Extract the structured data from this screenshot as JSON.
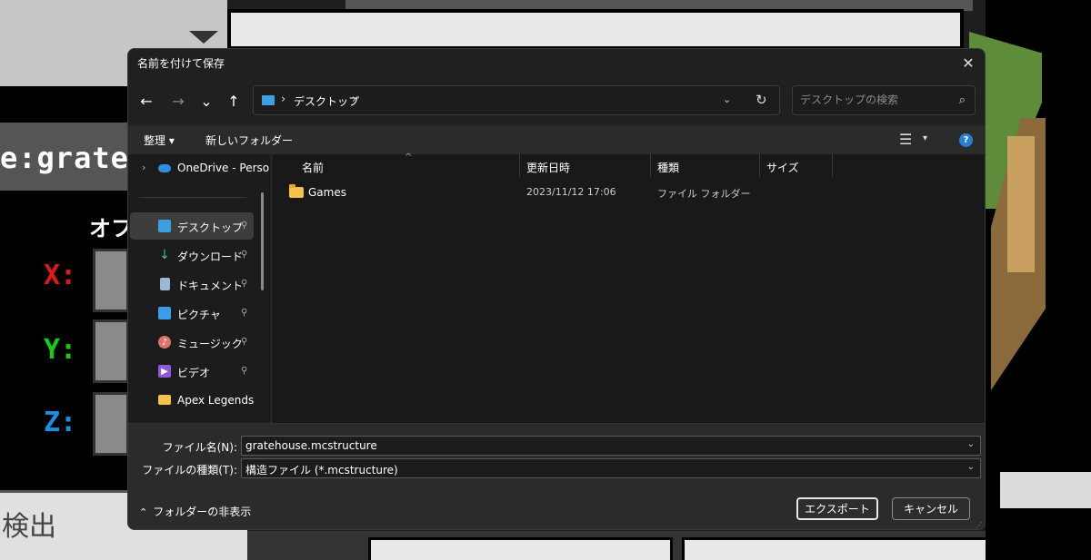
{
  "background": {
    "structure_name_partial": "e:grate",
    "ofu_partial": "オフ",
    "axis_x": "X:",
    "axis_y": "Y:",
    "axis_z": "Z:",
    "detect_label": "検出"
  },
  "dialog": {
    "title": "名前を付けて保存",
    "close_glyph": "✕",
    "nav": {
      "back": "←",
      "forward": "→",
      "recent": "⌄",
      "up": "↑"
    },
    "address": {
      "path": "デスクトップ",
      "chevron": "›",
      "dropdown": "⌄",
      "refresh": "↻"
    },
    "search": {
      "placeholder": "デスクトップの検索",
      "icon": "⌕"
    },
    "toolbar": {
      "organize": "整理 ▾",
      "new_folder": "新しいフォルダー",
      "view_icon": "☰",
      "view_dd": "▾",
      "help": "?"
    },
    "sidebar": {
      "onedrive": "OneDrive - Perso",
      "items": [
        {
          "label": "デスクトップ",
          "icon": "desktop-icon",
          "color": "#3aa0e0",
          "pinned": true,
          "selected": true
        },
        {
          "label": "ダウンロード",
          "icon": "download-icon",
          "color": "#3cc88c",
          "pinned": true
        },
        {
          "label": "ドキュメント",
          "icon": "document-icon",
          "color": "#9ab8d8",
          "pinned": true
        },
        {
          "label": "ピクチャ",
          "icon": "picture-icon",
          "color": "#3a9ee8",
          "pinned": true
        },
        {
          "label": "ミュージック",
          "icon": "music-icon",
          "color": "#e0706a",
          "pinned": true
        },
        {
          "label": "ビデオ",
          "icon": "video-icon",
          "color": "#8a5ad8",
          "pinned": true
        },
        {
          "label": "Apex Legends",
          "icon": "folder-icon",
          "color": "#f2c14e",
          "pinned": false
        }
      ],
      "pin_glyph": "📌"
    },
    "columns": {
      "name": "名前",
      "date": "更新日時",
      "type": "種類",
      "size": "サイズ"
    },
    "files": [
      {
        "name": "Games",
        "date": "2023/11/12 17:06",
        "type": "ファイル フォルダー"
      }
    ],
    "filename": {
      "label": "ファイル名(N):",
      "value": "gratehouse.mcstructure"
    },
    "filetype": {
      "label": "ファイルの種類(T):",
      "value": "構造ファイル (*.mcstructure)"
    },
    "hide_folders": "フォルダーの非表示",
    "export_button": "エクスポート",
    "cancel_button": "キャンセル"
  }
}
